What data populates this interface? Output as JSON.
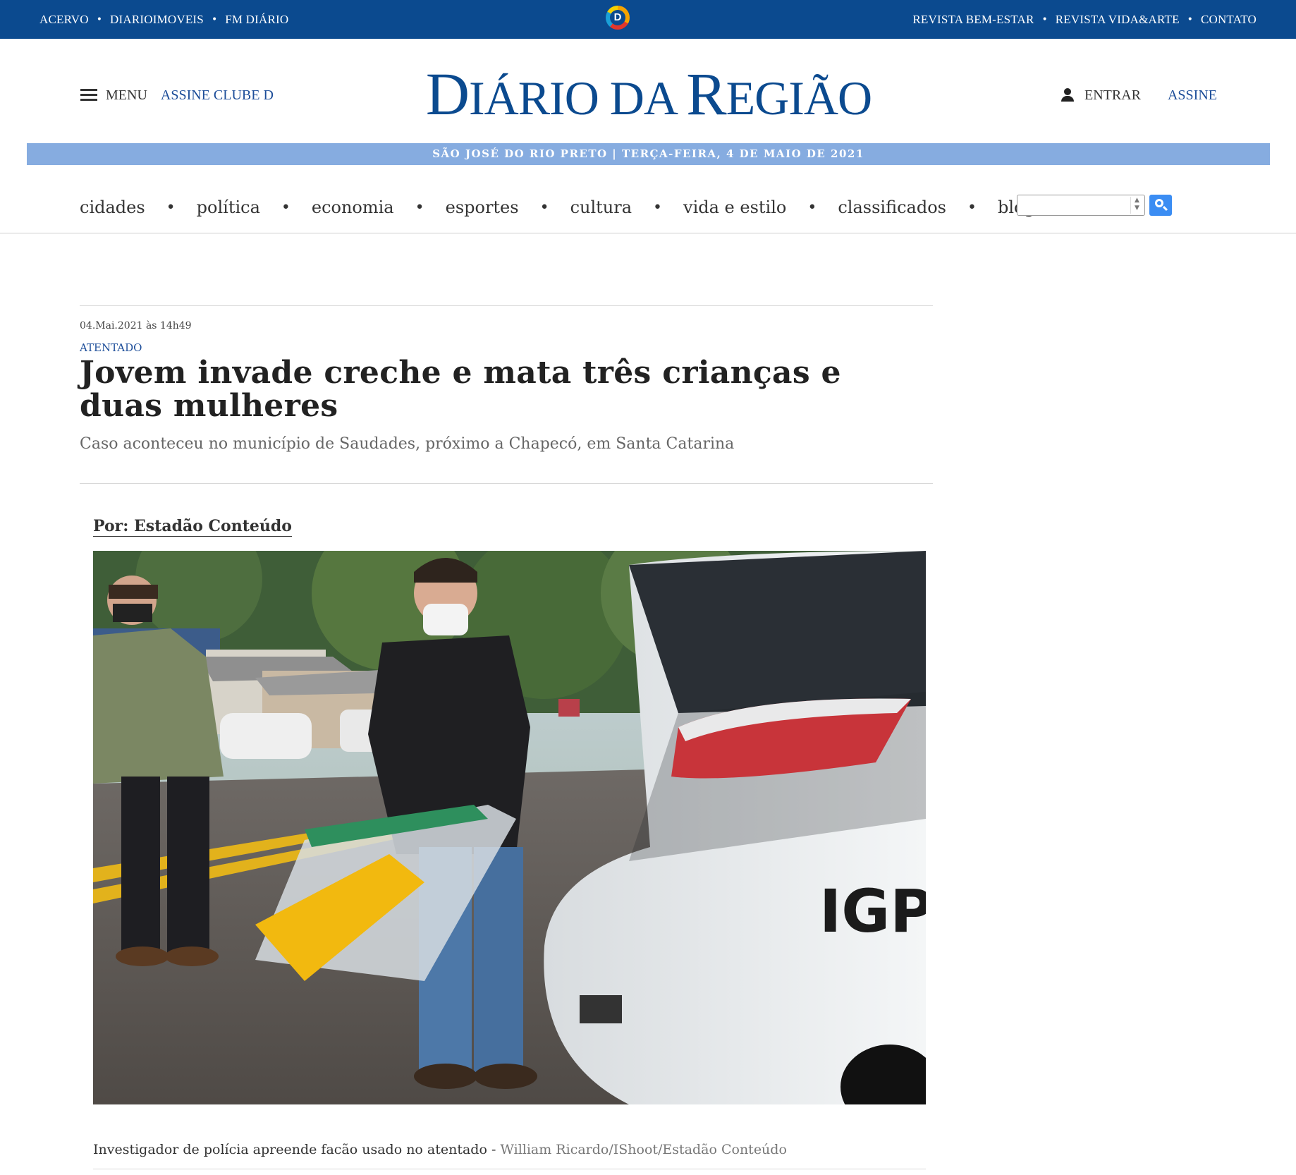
{
  "topbar": {
    "left_links": [
      "ACERVO",
      "DIARIOIMOVEIS",
      "FM DIÁRIO"
    ],
    "right_links": [
      "REVISTA BEM-ESTAR",
      "REVISTA VIDA&ARTE",
      "CONTATO"
    ],
    "logo_letter": "D",
    "separator": "•"
  },
  "header": {
    "menu_label": "MENU",
    "assine_clube": "ASSINE CLUBE D",
    "masthead": {
      "part1_big": "D",
      "part1_small": "IÁRIO",
      "part2_small": " DA ",
      "part3_big": "R",
      "part3_small": "EGIÃO"
    },
    "entrar_label": "ENTRAR",
    "assine_label": "ASSINE",
    "dateline": "SÃO JOSÉ DO RIO PRETO | TERÇA-FEIRA, 4 DE MAIO DE 2021"
  },
  "nav": {
    "items": [
      "cidades",
      "política",
      "economia",
      "esportes",
      "cultura",
      "vida e estilo",
      "classificados",
      "blogs"
    ],
    "separator": "•",
    "search_value": ""
  },
  "article": {
    "timestamp": "04.Mai.2021 às 14h49",
    "kicker": "ATENTADO",
    "headline": "Jovem invade creche e mata três crianças e duas mulheres",
    "subhead": "Caso aconteceu no município de Saudades, próximo a Chapecó, em Santa Catarina",
    "byline": "Por: Estadão Conteúdo",
    "photo_text": "IGPA",
    "caption": "Investigador de polícia apreende facão usado no atentado - ",
    "caption_credit": "William Ricardo/IShoot/Estadão Conteúdo"
  },
  "colors": {
    "topbar": "#0b4a8f",
    "brand_blue": "#0b4a8f",
    "link_blue": "#1c4d99",
    "dateline_bg": "#86ace0",
    "search_button": "#3b8df3"
  }
}
